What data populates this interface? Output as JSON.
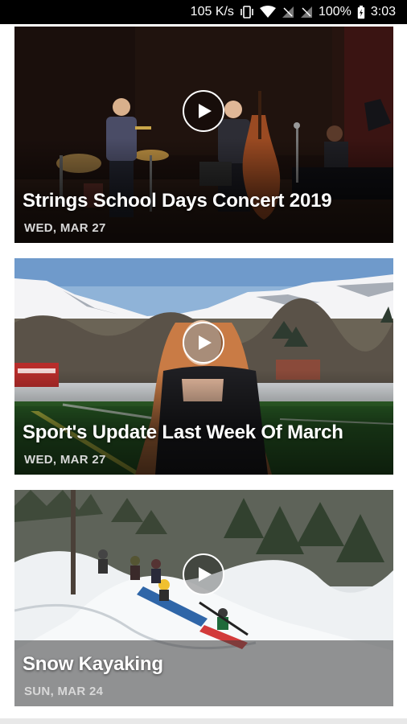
{
  "status_bar": {
    "speed": "105 K/s",
    "battery": "100%",
    "time": "3:03",
    "icons": [
      "vibrate-icon",
      "wifi-icon",
      "signal-icon",
      "signal-icon",
      "battery-icon"
    ]
  },
  "feed": {
    "items": [
      {
        "title": "Strings School Days Concert 2019",
        "date": "WED, MAR 27"
      },
      {
        "title": "Sport's Update Last Week Of March",
        "date": "WED, MAR 27"
      },
      {
        "title": "Snow Kayaking",
        "date": "SUN, MAR 24"
      }
    ]
  },
  "colors": {
    "status_bar_bg": "#000000",
    "page_bg": "#ffffff",
    "title_text": "#ffffff",
    "date_text": "#d8d8d8"
  }
}
